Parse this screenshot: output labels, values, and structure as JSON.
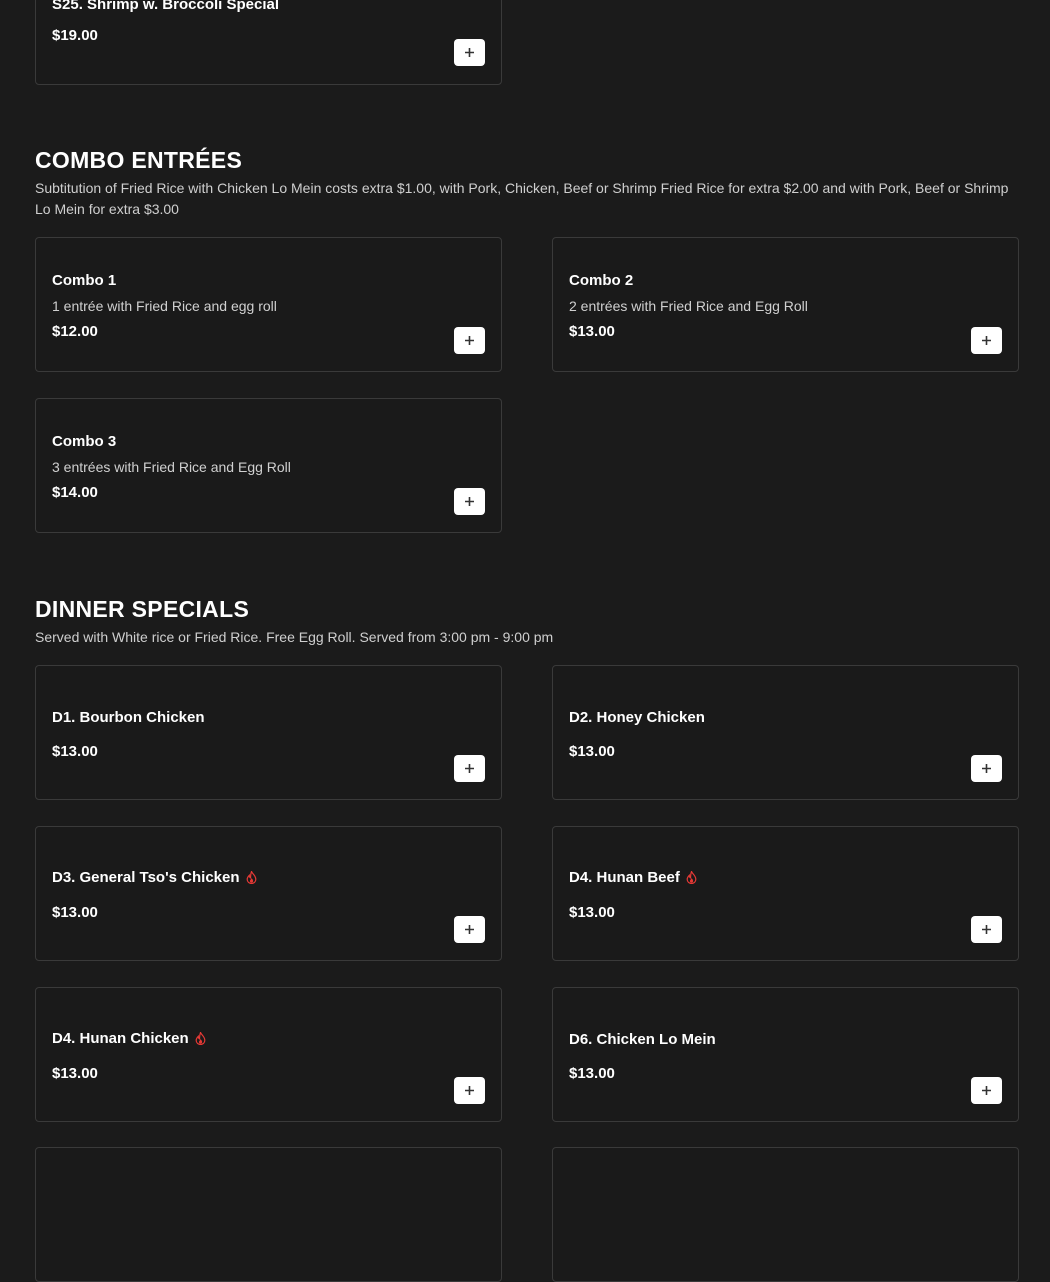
{
  "sections": [
    {
      "items": [
        {
          "name": "S25. Shrimp w. Broccoli Special",
          "price": "$19.00",
          "spicy": false
        }
      ]
    },
    {
      "title": "COMBO ENTRÉES",
      "description": "Subtitution of Fried Rice with Chicken Lo Mein costs extra $1.00, with Pork, Chicken, Beef or Shrimp Fried Rice for extra $2.00 and with Pork, Beef or Shrimp Lo Mein for extra $3.00",
      "items": [
        {
          "name": "Combo 1",
          "description": "1 entrée with Fried Rice and egg roll",
          "price": "$12.00"
        },
        {
          "name": "Combo 2",
          "description": "2 entrées with Fried Rice and Egg Roll",
          "price": "$13.00"
        },
        {
          "name": "Combo 3",
          "description": "3 entrées with Fried Rice and Egg Roll",
          "price": "$14.00"
        }
      ]
    },
    {
      "title": "DINNER SPECIALS",
      "description": "Served with White rice or Fried Rice. Free Egg Roll. Served from 3:00 pm - 9:00 pm",
      "items": [
        {
          "name": "D1. Bourbon Chicken",
          "price": "$13.00",
          "spicy": false
        },
        {
          "name": "D2. Honey Chicken",
          "price": "$13.00",
          "spicy": false
        },
        {
          "name": "D3. General Tso's Chicken",
          "price": "$13.00",
          "spicy": true
        },
        {
          "name": "D4. Hunan Beef",
          "price": "$13.00",
          "spicy": true
        },
        {
          "name": "D4. Hunan Chicken",
          "price": "$13.00",
          "spicy": true
        },
        {
          "name": "D6. Chicken Lo Mein",
          "price": "$13.00",
          "spicy": false
        }
      ]
    }
  ],
  "colors": {
    "background": "#1b1b1b",
    "card_background": "#1a1a1a",
    "card_border": "#3a3a3a",
    "spicy_icon": "#e53935",
    "add_button": "#ffffff"
  },
  "icons": {
    "add": "plus-icon",
    "spicy": "flame-icon"
  }
}
